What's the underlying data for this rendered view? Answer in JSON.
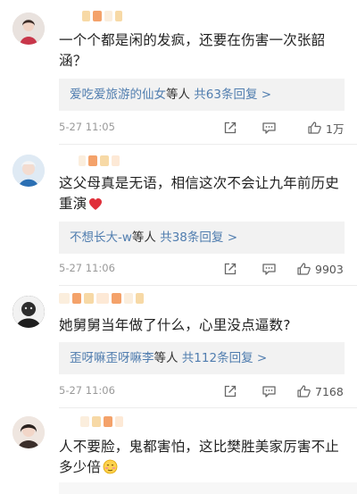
{
  "comments": [
    {
      "text": "一个个都是闲的发疯，还要在伤害一次张韶涵？",
      "reply_users": "爱吃爱旅游的仙女",
      "reply_suffix": "等人",
      "reply_count": "共63条回复 >",
      "time": "5-27 11:05",
      "likes": "1万"
    },
    {
      "text": "这父母真是无语，相信这次不会让九年前历史重演",
      "emoji": "heart",
      "reply_users": "不想长大-w",
      "reply_suffix": "等人",
      "reply_count": "共38条回复 >",
      "time": "5-27 11:06",
      "likes": "9903"
    },
    {
      "text": "她舅舅当年做了什么，心里没点逼数?",
      "reply_users": "歪呀嘛歪呀嘛李",
      "reply_suffix": "等人",
      "reply_count": "共112条回复 >",
      "time": "5-27 11:06",
      "likes": "7168"
    },
    {
      "text": "人不要脸，鬼都害怕，这比樊胜美家厉害不止多少倍",
      "emoji": "shy-face"
    }
  ],
  "icons": {
    "forward": "share-square-icon",
    "reply": "comment-bubble-icon",
    "like": "thumbs-up-icon"
  },
  "colors": {
    "link_blue": "#507daf",
    "blur_orange": "#f4a26a",
    "blur_yellow": "#f7d9a6",
    "meta_gray": "#999999",
    "reply_bg": "#f2f2f2"
  }
}
